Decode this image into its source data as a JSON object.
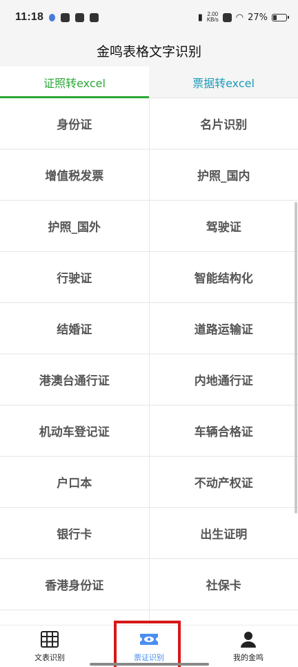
{
  "status_bar": {
    "time": "11:18",
    "net_speed": "2.00",
    "net_unit": "KB/s",
    "battery": "27%"
  },
  "header": {
    "title": "金鸣表格文字识别"
  },
  "tabs": [
    {
      "label": "证照转excel",
      "active": true
    },
    {
      "label": "票据转excel",
      "active": false
    }
  ],
  "grid": [
    [
      "身份证",
      "名片识别"
    ],
    [
      "增值税发票",
      "护照_国内"
    ],
    [
      "护照_国外",
      "驾驶证"
    ],
    [
      "行驶证",
      "智能结构化"
    ],
    [
      "结婚证",
      "道路运输证"
    ],
    [
      "港澳台通行证",
      "内地通行证"
    ],
    [
      "机动车登记证",
      "车辆合格证"
    ],
    [
      "户口本",
      "不动产权证"
    ],
    [
      "银行卡",
      "出生证明"
    ],
    [
      "香港身份证",
      "社保卡"
    ]
  ],
  "bottom_nav": [
    {
      "label": "文表识别",
      "icon": "table-icon"
    },
    {
      "label": "票证识别",
      "icon": "ticket-eye-icon",
      "active": true
    },
    {
      "label": "我的金鸣",
      "icon": "user-icon"
    }
  ],
  "colors": {
    "accent_green": "#2aa836",
    "accent_blue": "#1a9ab8",
    "nav_active": "#4a8ef0"
  }
}
